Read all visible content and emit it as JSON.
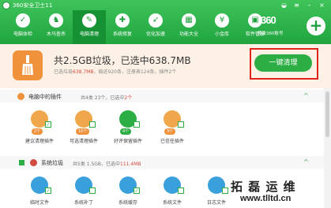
{
  "titlebar": {
    "app_title": "360安全卫士11",
    "menu_glyph": "≡",
    "min_glyph": "–",
    "close_glyph": "×"
  },
  "nav": {
    "items": [
      {
        "label": "电脑体检",
        "icon": "shield-check-icon",
        "glyph": "✓"
      },
      {
        "label": "木马查杀",
        "icon": "horse-icon",
        "glyph": "♞"
      },
      {
        "label": "电脑清理",
        "icon": "broom-icon",
        "glyph": "✎"
      },
      {
        "label": "系统修复",
        "icon": "wrench-shield-icon",
        "glyph": "✚"
      },
      {
        "label": "优化加速",
        "icon": "rocket-icon",
        "glyph": "➶"
      },
      {
        "label": "功能大全",
        "icon": "grid-icon",
        "glyph": "▦"
      },
      {
        "label": "小金库",
        "icon": "coin-icon",
        "glyph": "¥"
      },
      {
        "label": "软件管家",
        "icon": "bag-icon",
        "glyph": "▣"
      }
    ],
    "active_index": 2
  },
  "brand": {
    "logo_text": "360",
    "sub_text": "登录360账号",
    "plus_glyph": "+"
  },
  "summary": {
    "headline": "共2.5GB垃圾，已选中638.7MB",
    "sub_prefix": "已选垃圾",
    "sub_size": "638.7MB",
    "sub_rest": "，痕迹920条，注册表124条，插件2个",
    "clean_button": "一键清理"
  },
  "sections": [
    {
      "title": "电脑中的插件",
      "meta_prefix": "共4类 23个，已选中",
      "meta_value": "2个",
      "chevron": "^",
      "items": [
        {
          "label": "建议清理插件",
          "badge": "2个",
          "badge_color": "#f0913c",
          "checked": true,
          "icon_color": "#f0a64a",
          "icon": "puzzle-icon"
        },
        {
          "label": "可选清理插件",
          "badge": "16个",
          "badge_color": "#f0913c",
          "checked": false,
          "icon_color": "#f0a64a",
          "icon": "puzzle-icon"
        },
        {
          "label": "好评保留插件",
          "badge": "4个",
          "badge_color": "#2cae44",
          "checked": false,
          "icon_color": "#2cae44",
          "icon": "puzzle-icon"
        },
        {
          "label": "已信任插件",
          "badge": "3个",
          "badge_color": "#f0913c",
          "checked": false,
          "icon_color": "#f0a64a",
          "icon": "puzzle-icon"
        }
      ]
    },
    {
      "title": "系统垃圾",
      "meta_prefix": "共5类 1.5GB，已选中",
      "meta_value": "111.4MB",
      "chevron": "^",
      "items": [
        {
          "label": "临时文件",
          "checked": true,
          "icon_color": "#3aa0dc",
          "icon": "clock-icon"
        },
        {
          "label": "系统补丁",
          "checked": false,
          "icon_color": "#3aa0dc",
          "icon": "patch-icon"
        },
        {
          "label": "系统缓存",
          "checked": true,
          "icon_color": "#3aa0dc",
          "icon": "database-icon"
        },
        {
          "label": "系统文件",
          "checked": false,
          "icon_color": "#3aa0dc",
          "icon": "folder-icon"
        },
        {
          "label": "日志文件",
          "checked": false,
          "icon_color": "#3aa0dc",
          "icon": "document-icon"
        }
      ]
    }
  ],
  "watermark": {
    "text": "拓 磊 运 维",
    "url": "www.tlltd.cn"
  }
}
